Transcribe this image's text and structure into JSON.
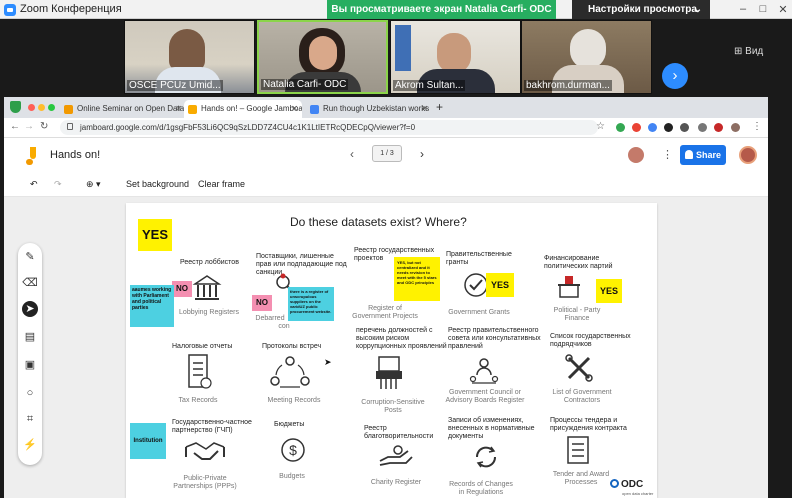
{
  "zoom": {
    "title": "Zoom Конференция",
    "share_banner": "Вы просматриваете экран Natalia Carfi- ODC",
    "view_options": "Настройки просмотра",
    "view_label": "Вид"
  },
  "participants": [
    {
      "name": "OSCE PCUz Umid..."
    },
    {
      "name": "Natalia Carfi- ODC"
    },
    {
      "name": "Akrom Sultan..."
    },
    {
      "name": "bakhrom.durman..."
    }
  ],
  "browser": {
    "tabs": [
      {
        "label": "Online Seminar on Open Data"
      },
      {
        "label": "Hands on! – Google Jamboard"
      },
      {
        "label": "Run though Uzbekistan works"
      }
    ],
    "url": "jamboard.google.com/d/1gsgFbF53Li6QC9qSzLDD7Z4CU4c1K1LtIETRcQDECpQ/viewer?f=0"
  },
  "jamboard": {
    "title": "Hands on!",
    "frame_indicator": "1 / 3",
    "share_label": "Share",
    "set_background": "Set background",
    "clear_frame": "Clear frame"
  },
  "board": {
    "title": "Do these datasets exist? Where?",
    "items": {
      "lobby": {
        "ru": "Реестр лоббистов",
        "en": "Lobbying Registers"
      },
      "suppliers": {
        "ru": "Поставщики, лишенные прав или подпадающие под санкции",
        "en": "Debarred",
        "en2": "con"
      },
      "state_reg": {
        "ru": "Реестр государственных проектов",
        "en": "Register of Government Projects"
      },
      "grants": {
        "ru": "Правительственные гранты",
        "en": "Government Grants"
      },
      "party": {
        "ru": "Финансирование политических партий",
        "en": "Political - Party Finance"
      },
      "tax": {
        "ru": "Налоговые отчеты",
        "en": "Tax Records"
      },
      "meetings": {
        "ru": "Протоколы встреч",
        "en": "Meeting Records"
      },
      "corruption": {
        "ru": "перечень должностей с высоким риском коррупционных проявлений",
        "en": "Corruption-Sensitive Posts"
      },
      "council": {
        "ru": "Реестр правительственного совета или консультативных правлений",
        "en": "Government Council or Advisory Boards Register"
      },
      "contractors": {
        "ru": "Список государственных подрядчиков",
        "en": "List of Government Contractors"
      },
      "ppp": {
        "ru": "Государственно-частное партнерство (ГЧП)",
        "en": "Public-Private Partnerships (PPPs)"
      },
      "budgets": {
        "ru": "Бюджеты",
        "en": "Budgets"
      },
      "charity": {
        "ru": "Реестр благотворительности",
        "en": "Charity Register"
      },
      "regs": {
        "ru": "Записи об изменениях, внесенных в нормативные документы",
        "en": "Records of Changes in Regulations"
      },
      "tender": {
        "ru": "Процессы тендера и присуждения контракта",
        "en": "Tender and Award Processes"
      }
    },
    "stickies": {
      "yes_big": "YES",
      "no1": "NO",
      "no2": "NO",
      "yes_grants": "YES",
      "yes_party": "YES",
      "oliy": "aaumes working with Parliament and political parties",
      "supplier_note": "there is a register of unscrupulous suppliers on the xaridUZ public procurement website.",
      "state_note": "YES, but not centralized and it needs revision to meet with the 5 stars and ODC principles",
      "institution": "Institution"
    },
    "odc": "ODC",
    "odc_sub": "open data charter"
  }
}
